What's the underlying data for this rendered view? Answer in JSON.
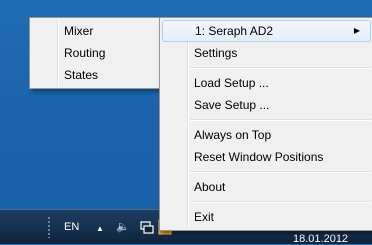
{
  "desktop": {
    "background_color": "#1a64ab"
  },
  "left_menu": {
    "items": [
      {
        "label": "Mixer"
      },
      {
        "label": "Routing"
      },
      {
        "label": "States"
      }
    ]
  },
  "main_menu": {
    "device_item": {
      "label": "1: Seraph AD2",
      "submenu_arrow": "▶"
    },
    "settings": "Settings",
    "load_setup": "Load Setup ...",
    "save_setup": "Save Setup ...",
    "always_on_top": "Always on Top",
    "reset_window_positions": "Reset Window Positions",
    "about": "About",
    "exit": "Exit"
  },
  "taskbar": {
    "language": "EN",
    "show_hidden_icon": "▲",
    "volume_icon": "🔈",
    "date": "18.01.2012"
  }
}
